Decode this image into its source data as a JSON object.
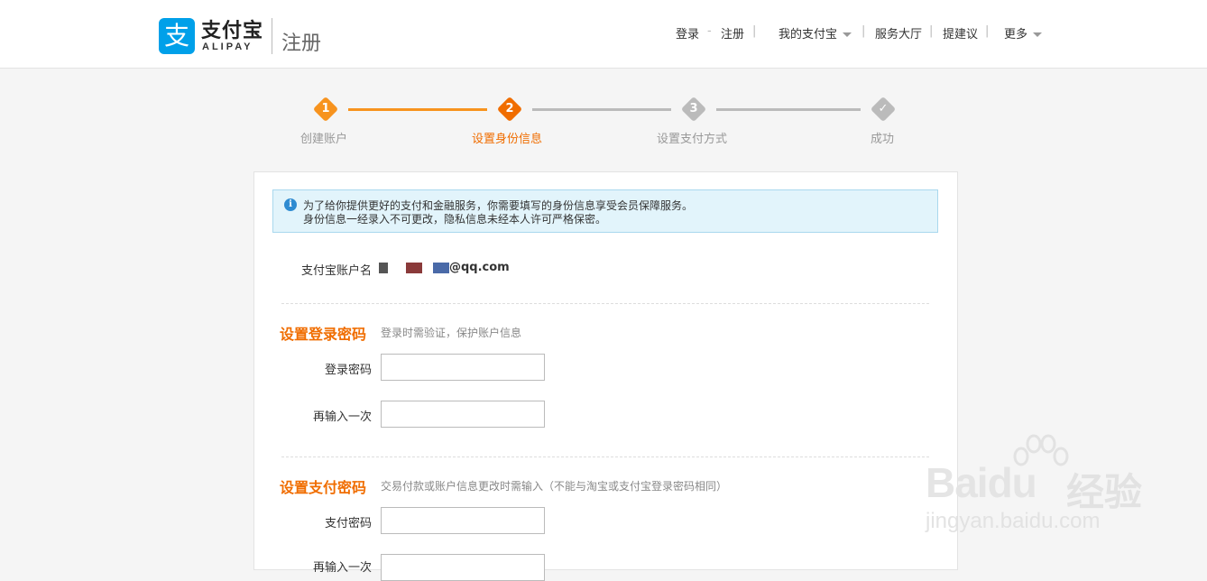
{
  "header": {
    "logo_glyph": "支",
    "logo_name": "支付宝",
    "logo_sub": "ALIPAY",
    "page_title": "注册",
    "nav": {
      "login": "登录",
      "dash": "-",
      "register": "注册",
      "sep": "|",
      "my_alipay": "我的支付宝",
      "service_hall": "服务大厅",
      "suggestion": "提建议",
      "more": "更多"
    }
  },
  "steps": [
    {
      "num": "1",
      "label": "创建账户",
      "state": "done"
    },
    {
      "num": "2",
      "label": "设置身份信息",
      "state": "current"
    },
    {
      "num": "3",
      "label": "设置支付方式",
      "state": "pending"
    },
    {
      "num": "✓",
      "label": "成功",
      "state": "pending"
    }
  ],
  "colors": {
    "accent": "#f06d00",
    "step_done": "#f7931e",
    "step_current": "#f06d00",
    "step_pending": "#bbbbbb",
    "notice_bg": "#e2f4fb",
    "brand_blue": "#00a0e9"
  },
  "notice": {
    "line1": "为了给你提供更好的支付和金融服务，你需要填写的身份信息享受会员保障服务。",
    "line2": "身份信息一经录入不可更改，隐私信息未经本人许可严格保密。"
  },
  "account": {
    "label": "支付宝账户名",
    "value_suffix": "@qq.com"
  },
  "login_password": {
    "title": "设置登录密码",
    "hint": "登录时需验证，保护账户信息",
    "field1_label": "登录密码",
    "field1_value": "",
    "field2_label": "再输入一次",
    "field2_value": ""
  },
  "pay_password": {
    "title": "设置支付密码",
    "hint": "交易付款或账户信息更改时需输入（不能与淘宝或支付宝登录密码相同）",
    "field1_label": "支付密码",
    "field1_value": "",
    "field2_label": "再输入一次",
    "field2_value": ""
  },
  "watermark": {
    "brand": "Baidu",
    "cn": "经验",
    "url": "jingyan.baidu.com"
  }
}
